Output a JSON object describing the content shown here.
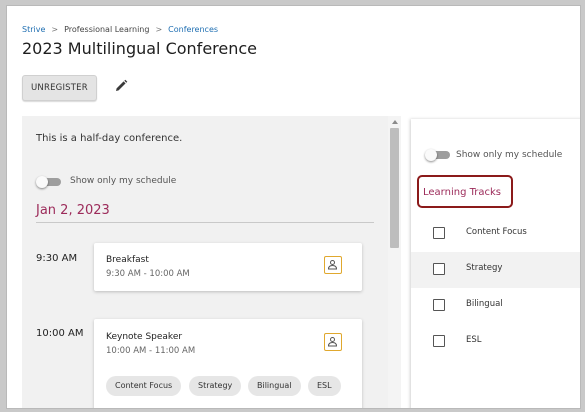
{
  "breadcrumb": {
    "items": [
      "Strive",
      "Professional Learning",
      "Conferences"
    ],
    "separator": ">"
  },
  "page": {
    "title": "2023 Multilingual Conference",
    "unregister_label": "UNREGISTER",
    "edit_icon": "pencil-icon"
  },
  "schedule": {
    "description": "This is a half-day conference.",
    "toggle_label": "Show only my schedule",
    "date": "Jan 2, 2023",
    "sessions": [
      {
        "time": "9:30 AM",
        "title": "Breakfast",
        "range": "9:30 AM - 10:00 AM",
        "icon": "person-icon",
        "tags": []
      },
      {
        "time": "10:00 AM",
        "title": "Keynote Speaker",
        "range": "10:00 AM - 11:00 AM",
        "icon": "person-icon",
        "tags": [
          "Content Focus",
          "Strategy",
          "Bilingual",
          "ESL"
        ]
      }
    ]
  },
  "filters": {
    "toggle_label": "Show only my schedule",
    "heading": "Learning Tracks",
    "tracks": [
      {
        "label": "Content Focus",
        "checked": false
      },
      {
        "label": "Strategy",
        "checked": false
      },
      {
        "label": "Bilingual",
        "checked": false
      },
      {
        "label": "ESL",
        "checked": false
      }
    ]
  },
  "colors": {
    "accent": "#9c2b5a",
    "link": "#1f6fb2",
    "icon_border": "#e0a82e",
    "highlight_box": "#8b1a1a"
  }
}
